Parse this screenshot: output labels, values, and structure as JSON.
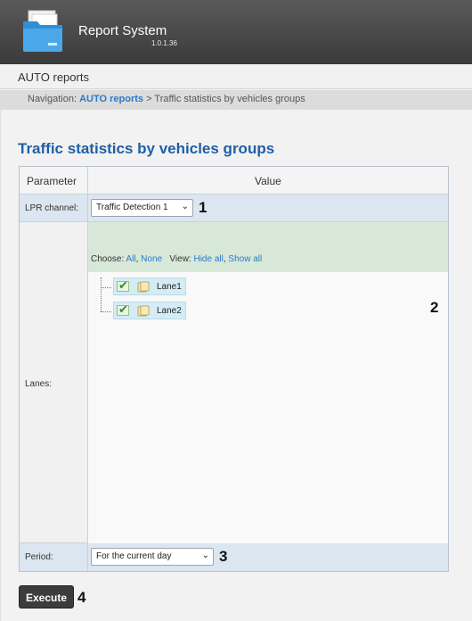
{
  "header": {
    "app_title": "Report System",
    "version": "1.0.1.36",
    "logo_icon": "folder-icon"
  },
  "section": {
    "title": "AUTO reports"
  },
  "breadcrumb": {
    "prefix": "Navigation:",
    "link": "AUTO reports",
    "separator": ">",
    "current": "Traffic statistics by vehicles groups"
  },
  "page": {
    "title": "Traffic statistics by vehicles groups"
  },
  "table": {
    "header_parameter": "Parameter",
    "header_value": "Value"
  },
  "lpr": {
    "label": "LPR channel:",
    "selected": "Traffic Detection 1",
    "marker": "1"
  },
  "lanes": {
    "label": "Lanes:",
    "choose_label": "Choose:",
    "choose_all": "All",
    "choose_none": "None",
    "view_label": "View:",
    "hide_all": "Hide all",
    "show_all": "Show all",
    "items": [
      {
        "label": "Lane1",
        "checked": true
      },
      {
        "label": "Lane2",
        "checked": true
      }
    ],
    "marker": "2"
  },
  "period": {
    "label": "Period:",
    "selected": "For the current day",
    "marker": "3"
  },
  "execute": {
    "label": "Execute",
    "marker": "4"
  },
  "colors": {
    "header_bg": "#444444",
    "title_blue": "#1f5fa8",
    "link_blue": "#2a7ac9",
    "row_blue": "#dbe6f0",
    "lanes_green": "#d7e8d8",
    "node_bg": "#d5ecf5"
  }
}
